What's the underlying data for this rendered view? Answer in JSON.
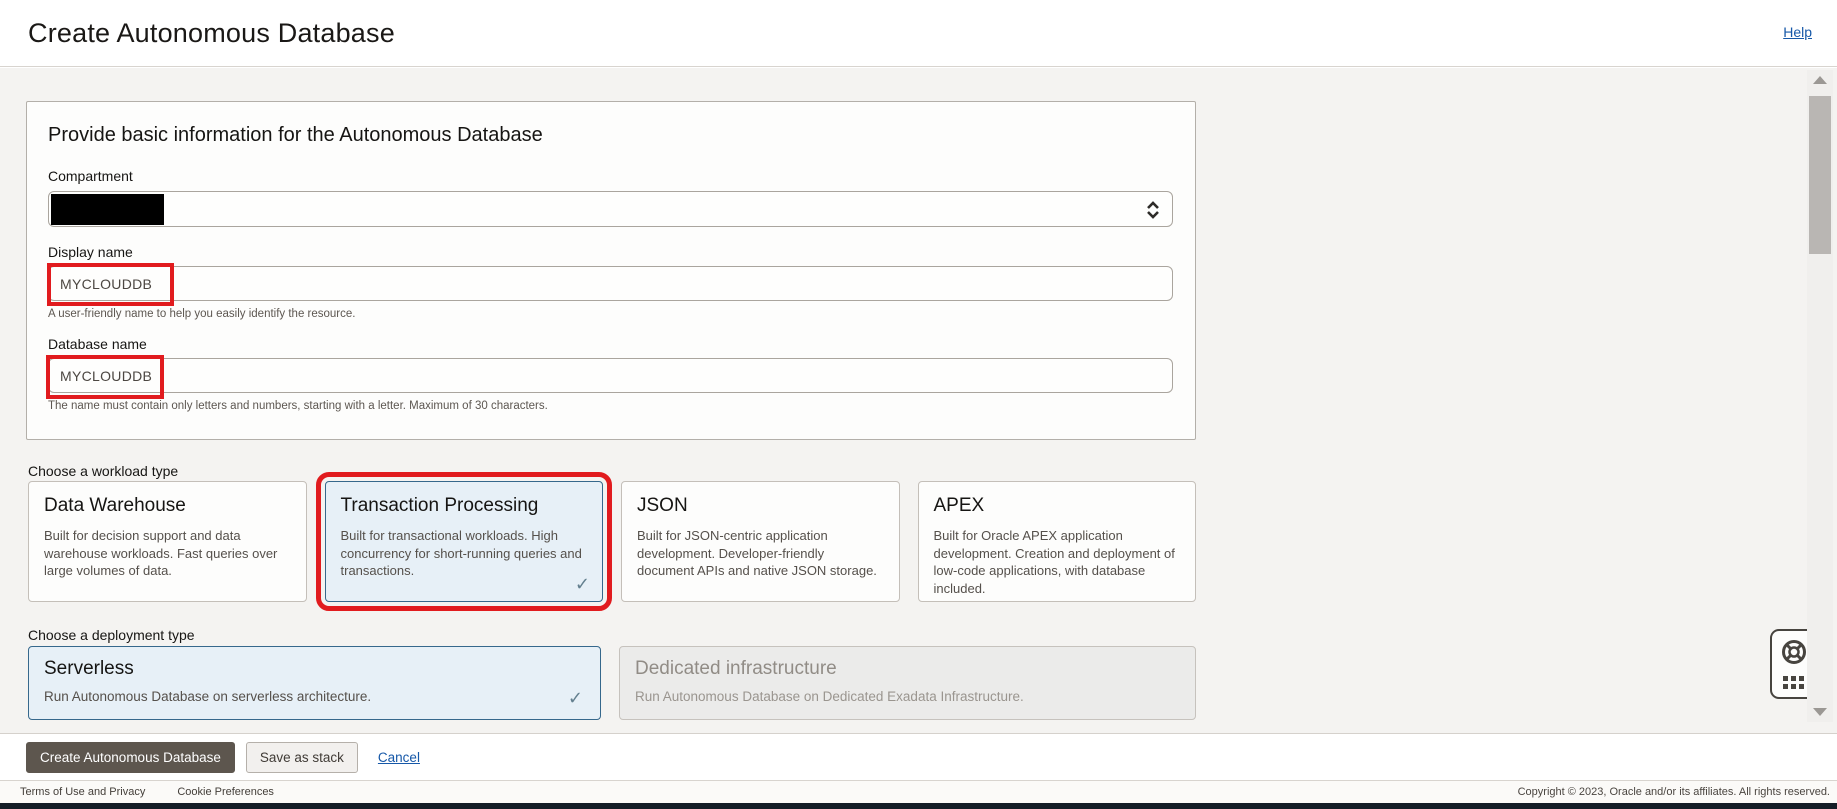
{
  "header": {
    "title": "Create Autonomous Database",
    "help_label": "Help"
  },
  "basic_info": {
    "heading": "Provide basic information for the Autonomous Database",
    "compartment": {
      "label": "Compartment",
      "value": ""
    },
    "display_name": {
      "label": "Display name",
      "value": "MYCLOUDDB",
      "helper": "A user-friendly name to help you easily identify the resource."
    },
    "database_name": {
      "label": "Database name",
      "value": "MYCLOUDDB",
      "helper": "The name must contain only letters and numbers, starting with a letter. Maximum of 30 characters."
    }
  },
  "workload": {
    "label": "Choose a workload type",
    "cards": [
      {
        "title": "Data Warehouse",
        "description": "Built for decision support and data warehouse workloads. Fast queries over large volumes of data.",
        "selected": false
      },
      {
        "title": "Transaction Processing",
        "description": "Built for transactional workloads. High concurrency for short-running queries and transactions.",
        "selected": true
      },
      {
        "title": "JSON",
        "description": "Built for JSON-centric application development. Developer-friendly document APIs and native JSON storage.",
        "selected": false
      },
      {
        "title": "APEX",
        "description": "Built for Oracle APEX application development. Creation and deployment of low-code applications, with database included.",
        "selected": false
      }
    ]
  },
  "deployment": {
    "label": "Choose a deployment type",
    "cards": [
      {
        "title": "Serverless",
        "description": "Run Autonomous Database on serverless architecture.",
        "selected": true,
        "disabled": false
      },
      {
        "title": "Dedicated infrastructure",
        "description": "Run Autonomous Database on Dedicated Exadata Infrastructure.",
        "selected": false,
        "disabled": true
      }
    ]
  },
  "actions": {
    "create_label": "Create Autonomous Database",
    "save_stack_label": "Save as stack",
    "cancel_label": "Cancel"
  },
  "footer": {
    "terms_label": "Terms of Use and Privacy",
    "cookie_label": "Cookie Preferences",
    "copyright": "Copyright © 2023, Oracle and/or its affiliates. All rights reserved."
  },
  "icons": {
    "check": "✓"
  },
  "colors": {
    "highlight_red": "#e11b1e",
    "selected_card_bg": "#e7f0f7",
    "selected_card_border": "#36688c",
    "link_blue": "#1658a8",
    "primary_button_bg": "#5d564e",
    "content_bg": "#f4f3f1",
    "bottom_strip": "#141d26"
  }
}
